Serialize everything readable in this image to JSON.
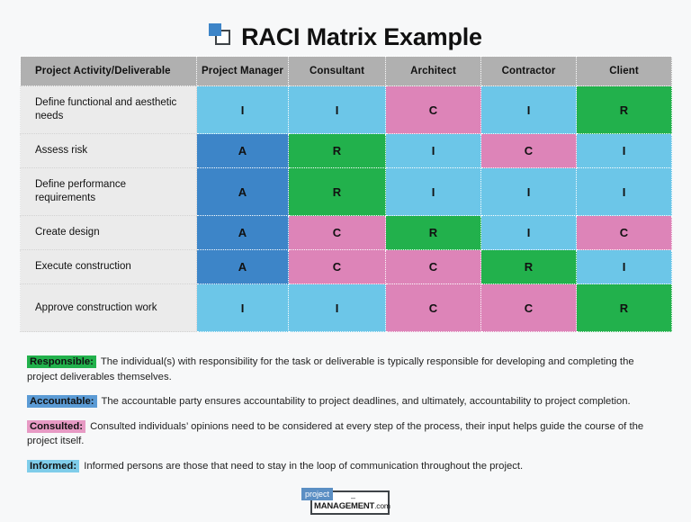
{
  "header": {
    "title": "RACI Matrix Example",
    "icon": "overlapping-squares-icon"
  },
  "matrix": {
    "columns": [
      "Project Activity/Deliverable",
      "Project Manager",
      "Consultant",
      "Architect",
      "Contractor",
      "Client"
    ],
    "rows": [
      {
        "activity": "Define functional and aesthetic needs",
        "values": [
          "I",
          "I",
          "C",
          "I",
          "R"
        ]
      },
      {
        "activity": "Assess risk",
        "values": [
          "A",
          "R",
          "I",
          "C",
          "I"
        ]
      },
      {
        "activity": "Define performance requirements",
        "values": [
          "A",
          "R",
          "I",
          "I",
          "I"
        ]
      },
      {
        "activity": "Create design",
        "values": [
          "A",
          "C",
          "R",
          "I",
          "C"
        ]
      },
      {
        "activity": "Execute construction",
        "values": [
          "A",
          "C",
          "C",
          "R",
          "I"
        ]
      },
      {
        "activity": "Approve construction work",
        "values": [
          "I",
          "I",
          "C",
          "C",
          "R"
        ]
      }
    ]
  },
  "legend": [
    {
      "tag": "Responsible:",
      "key": "R",
      "color": "#22b14c",
      "text": "The individual(s) with responsibility for the task or deliverable is typically responsible for developing and completing the project deliverables themselves."
    },
    {
      "tag": "Accountable:",
      "key": "A",
      "color": "#5b9bd5",
      "text": "The accountable party ensures accountability to project deadlines, and ultimately, accountability to project completion."
    },
    {
      "tag": "Consulted:",
      "key": "C",
      "color": "#e79ac4",
      "text": "Consulted individuals’ opinions need to be considered at every step of the process, their input helps guide the course of the project itself."
    },
    {
      "tag": "Informed:",
      "key": "I",
      "color": "#7fcdea",
      "text": "Informed persons are those that need to stay in the loop of communication throughout the project."
    }
  ],
  "footer": {
    "logo_project": "project",
    "logo_dash": "–",
    "logo_management": "MANAGEMENT",
    "logo_dotcom": ".com"
  },
  "colors": {
    "responsible": "#22b14c",
    "accountable": "#3d85c8",
    "consulted": "#dd84b8",
    "informed": "#6cc6e8",
    "header_gray": "#b0b0b0",
    "label_gray": "#ebebeb",
    "page_bg": "#f7f8f9",
    "brand_blue": "#5b8fc4"
  }
}
